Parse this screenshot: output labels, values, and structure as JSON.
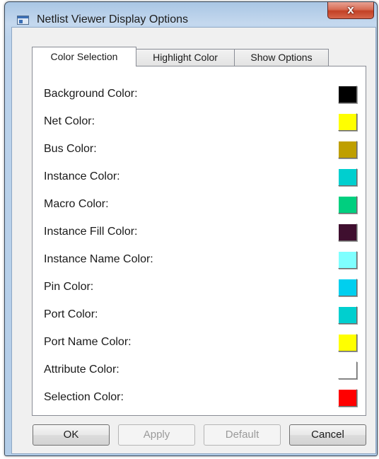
{
  "window": {
    "title": "Netlist Viewer Display Options",
    "close_label": "x"
  },
  "tabs": [
    {
      "label": "Color Selection",
      "active": true
    },
    {
      "label": "Highlight Color",
      "active": false
    },
    {
      "label": "Show Options",
      "active": false
    }
  ],
  "color_rows": [
    {
      "label": "Background Color:",
      "color": "#000000"
    },
    {
      "label": "Net Color:",
      "color": "#ffff00"
    },
    {
      "label": "Bus Color:",
      "color": "#bf9f00"
    },
    {
      "label": "Instance Color:",
      "color": "#00cfcf"
    },
    {
      "label": "Macro Color:",
      "color": "#00cf7f"
    },
    {
      "label": "Instance Fill Color:",
      "color": "#3f0f2f"
    },
    {
      "label": "Instance Name Color:",
      "color": "#7fffff"
    },
    {
      "label": "Pin Color:",
      "color": "#00cfef"
    },
    {
      "label": "Port Color:",
      "color": "#00cfcf"
    },
    {
      "label": "Port Name Color:",
      "color": "#ffff00"
    },
    {
      "label": "Attribute Color:",
      "color": "#ffffff"
    },
    {
      "label": "Selection Color:",
      "color": "#ff0000"
    }
  ],
  "buttons": {
    "ok": {
      "label": "OK",
      "enabled": true
    },
    "apply": {
      "label": "Apply",
      "enabled": false
    },
    "default": {
      "label": "Default",
      "enabled": false
    },
    "cancel": {
      "label": "Cancel",
      "enabled": true
    }
  }
}
